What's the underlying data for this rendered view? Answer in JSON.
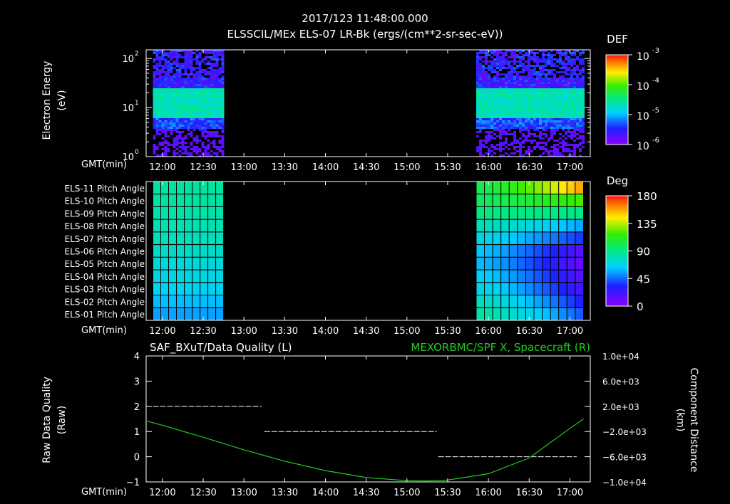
{
  "header": {
    "datetime": "2017/123 11:48:00.000",
    "subtitle": "ELSSCIL/MEx ELS-07 LR-Bk  (ergs/(cm**2-sr-sec-eV))"
  },
  "colors": {
    "background": "#000000",
    "axes": "#ffffff",
    "spacecraft_series": "#22cc22",
    "quality_series": "#ffffff",
    "grid_cells": "#000000"
  },
  "time_axis": {
    "label": "GMT(min)",
    "ticks": [
      "12:00",
      "12:30",
      "13:00",
      "13:30",
      "14:00",
      "14:30",
      "15:00",
      "15:30",
      "16:00",
      "16:30",
      "17:00"
    ]
  },
  "spectrogram": {
    "ylabel_line1": "Electron Energy",
    "ylabel_line2": "(eV)",
    "yticks": [
      "10",
      "10",
      "10"
    ],
    "ytick_exponents": [
      "0",
      "1",
      "2"
    ],
    "colorbar_title": "DEF",
    "colorbar_ticks": [
      "10",
      "10",
      "10",
      "10"
    ],
    "colorbar_exponents": [
      "-6",
      "-5",
      "-4",
      "-3"
    ]
  },
  "pitch": {
    "colorbar_title": "Deg",
    "colorbar_ticks": [
      "0",
      "45",
      "90",
      "135",
      "180"
    ],
    "rows": [
      "ELS-11 Pitch Angle",
      "ELS-10 Pitch Angle",
      "ELS-09 Pitch Angle",
      "ELS-08 Pitch Angle",
      "ELS-07 Pitch Angle",
      "ELS-06 Pitch Angle",
      "ELS-05 Pitch Angle",
      "ELS-04 Pitch Angle",
      "ELS-03 Pitch Angle",
      "ELS-02 Pitch Angle",
      "ELS-01 Pitch Angle"
    ]
  },
  "lineplot": {
    "left_title": "SAF_BXuT/Data Quality (L)",
    "right_title": "MEXORBMC/SPF X, Spacecraft (R)",
    "left_ylabel_line1": "Raw Data Quality",
    "left_ylabel_line2": "(Raw)",
    "right_ylabel_line1": "Component Distance",
    "right_ylabel_line2": "(km)",
    "left_ticks": [
      "4",
      "3",
      "2",
      "1",
      "0",
      "−1"
    ],
    "right_ticks": [
      "1.0e+04",
      "6.0e+03",
      "2.0e+03",
      "−2.0e+03",
      "−6.0e+03",
      "−1.0e+04"
    ]
  },
  "chart_data": [
    {
      "type": "heatmap",
      "title": "ELSSCIL/MEx ELS-07 LR-Bk  (ergs/(cm**2-sr-sec-eV))",
      "ylabel": "Electron Energy (eV)",
      "xlabel": "GMT(min)",
      "y_scale": "log",
      "ylim": [
        1,
        150
      ],
      "color_scale": "log",
      "colorbar_label": "DEF",
      "color_range": [
        1e-06,
        0.001
      ],
      "data_intervals": [
        [
          "11:53",
          "12:45"
        ],
        [
          "15:51",
          "17:10"
        ]
      ],
      "dominant_band_eV": [
        6,
        25
      ]
    },
    {
      "type": "heatmap",
      "title": "Pitch Angle",
      "xlabel": "GMT(min)",
      "rows": [
        "ELS-11",
        "ELS-10",
        "ELS-09",
        "ELS-08",
        "ELS-07",
        "ELS-06",
        "ELS-05",
        "ELS-04",
        "ELS-03",
        "ELS-02",
        "ELS-01"
      ],
      "colorbar_label": "Deg",
      "color_range": [
        0,
        180
      ],
      "data_intervals": [
        [
          "11:53",
          "12:45"
        ],
        [
          "15:51",
          "17:10"
        ]
      ],
      "interval1_pitch_deg_top_to_bottom": [
        85,
        84,
        83,
        81,
        79,
        76,
        72,
        70,
        66,
        60,
        55
      ],
      "interval2_pitch_deg_start_top_to_bottom": [
        100,
        98,
        92,
        80,
        70,
        62,
        60,
        65,
        70,
        78,
        85
      ],
      "interval2_pitch_deg_end_top_to_bottom": [
        160,
        120,
        90,
        55,
        35,
        15,
        10,
        15,
        20,
        30,
        40
      ]
    },
    {
      "type": "line",
      "title": "SAF_BXuT/Data Quality (L)",
      "ylabel": "Raw Data Quality (Raw)",
      "ylim": [
        -1,
        4
      ],
      "series": [
        {
          "name": "SAF_BXuT/Data Quality",
          "segments": [
            {
              "x": [
                "11:53",
                "13:13"
              ],
              "y": 2
            },
            {
              "x": [
                "13:15",
                "15:22"
              ],
              "y": 1
            },
            {
              "x": [
                "15:23",
                "17:05"
              ],
              "y": 0
            }
          ]
        }
      ]
    },
    {
      "type": "line",
      "title": "MEXORBMC/SPF X, Spacecraft (R)",
      "ylabel": "Component Distance (km)",
      "ylim": [
        -10000,
        10000
      ],
      "series": [
        {
          "name": "MEXORBMC/SPF X, Spacecraft",
          "x": [
            "11:48",
            "12:00",
            "12:30",
            "13:00",
            "13:30",
            "14:00",
            "14:30",
            "15:00",
            "15:15",
            "15:30",
            "16:00",
            "16:30",
            "17:00",
            "17:10"
          ],
          "y": [
            -300,
            -1000,
            -2900,
            -4900,
            -6700,
            -8200,
            -9300,
            -9800,
            -9850,
            -9700,
            -8700,
            -6200,
            -1500,
            0
          ]
        }
      ]
    }
  ]
}
